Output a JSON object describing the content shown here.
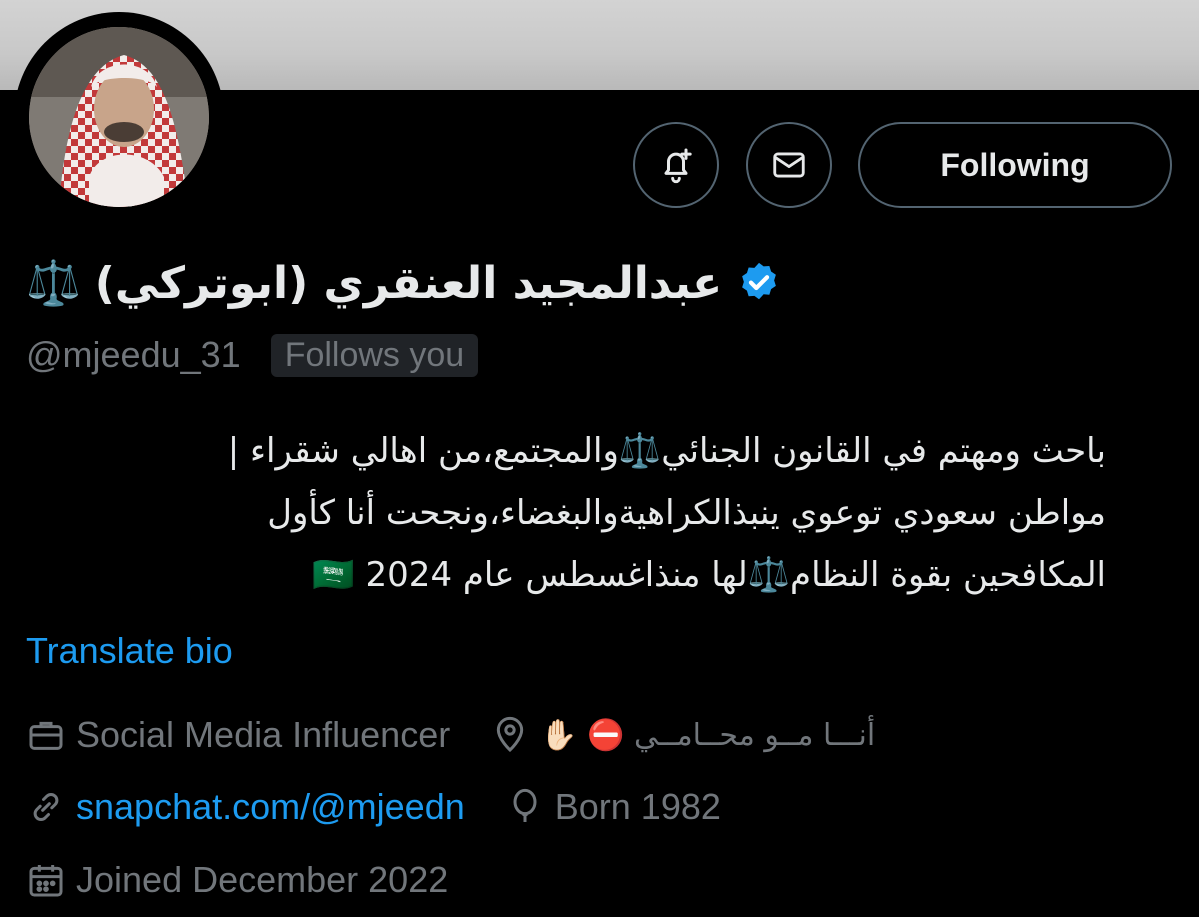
{
  "profile": {
    "display_name": "عبدالمجيد العنقري (ابوتركي)",
    "name_emoji": "⚖️",
    "handle": "@mjeedu_31",
    "follows_you": "Follows you",
    "bio_lines": [
      "باحث ومهتم في القانون الجنائي⚖️والمجتمع،من اهالي شقراء |",
      "مواطن سعودي توعوي ينبذالكراهيةوالبغضاء،ونجحت أنا كأول",
      "المكافحين بقوة النظام⚖️لها منذاغسطس عام 🇸🇦 2024"
    ],
    "translate_label": "Translate bio",
    "occupation": "Social Media Influencer",
    "location": "أنـــا مــو محــامــي ⛔ ✋🏻",
    "website": "snapchat.com/@mjeedn",
    "born": "Born 1982",
    "joined": "Joined December 2022"
  },
  "actions": {
    "following_label": "Following"
  },
  "colors": {
    "background": "#000000",
    "text": "#e7e9ea",
    "muted": "#71767b",
    "link": "#1d9bf0",
    "border": "#536471"
  }
}
